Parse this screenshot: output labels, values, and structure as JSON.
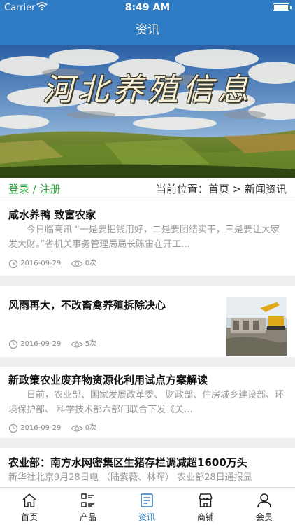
{
  "statusbar": {
    "carrier": "Carrier",
    "time": "8:49 AM"
  },
  "header": {
    "title": "资讯"
  },
  "banner": {
    "title": "河北养殖信息"
  },
  "locbar": {
    "login": "登录",
    "separator": " / ",
    "register": "注册",
    "location_label": "当前位置：",
    "home": "首页",
    "arrow": " > ",
    "current": "新闻资讯"
  },
  "news": [
    {
      "title": "咸水养鸭 致富农家",
      "summary": "今日临高讯 “一是要把钱用好，二是要团结实干，三是要让大家发大财。”省机关事务管理局局长陈宙在开工...",
      "date": "2016-09-29",
      "views": "0次"
    },
    {
      "title": "风雨再大，不改畜禽养殖拆除决心",
      "summary": "",
      "date": "2016-09-29",
      "views": "5次"
    },
    {
      "title": "新政策农业废弃物资源化利用试点方案解读",
      "summary": "日前，农业部、国家发展改革委、 财政部、住房城乡建设部、环境保护部、 科学技术部六部门联合下发《关...",
      "date": "2016-09-29",
      "views": "0次"
    },
    {
      "title": "农业部：南方水网密集区生猪存栏调减超1600万头",
      "summary": "新华社北京9月28日电 （陆紫薇、林晖） 农业部28日通报显",
      "date": "",
      "views": ""
    }
  ],
  "tabs": [
    {
      "label": "首页",
      "icon": "home-icon"
    },
    {
      "label": "产品",
      "icon": "grid-list-icon"
    },
    {
      "label": "资讯",
      "icon": "document-icon",
      "active": true
    },
    {
      "label": "商铺",
      "icon": "store-icon"
    },
    {
      "label": "会员",
      "icon": "user-icon"
    }
  ],
  "colors": {
    "primary": "#2f7cc4",
    "login": "#2aa238"
  }
}
